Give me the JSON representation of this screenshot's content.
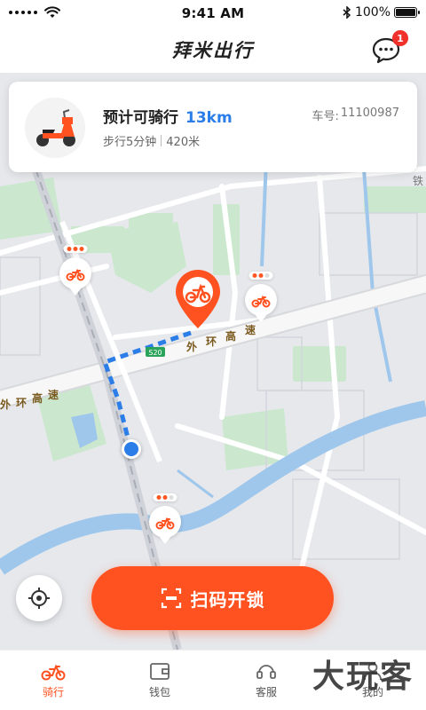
{
  "status": {
    "time": "9:41 AM",
    "battery": "100%"
  },
  "header": {
    "title": "拜米出行",
    "message_badge": "1"
  },
  "card": {
    "label": "预计可骑行",
    "range": "13km",
    "walk": "步行5分钟",
    "distance": "420米",
    "plate_label": "车号:",
    "plate_number": "11100987"
  },
  "map": {
    "road_labels": [
      "外",
      "环",
      "高",
      "速",
      "外",
      "环",
      "高",
      "速"
    ],
    "road_code": "S20",
    "rail_label": "铁"
  },
  "markers": [
    {
      "name": "bike-marker-1",
      "battery_level": 3
    },
    {
      "name": "bike-marker-2",
      "battery_level": 2
    },
    {
      "name": "bike-marker-3",
      "battery_level": 2
    }
  ],
  "scan_button": {
    "label": "扫码开锁"
  },
  "tabs": [
    {
      "id": "ride",
      "label": "骑行",
      "icon": "bike-icon",
      "active": true
    },
    {
      "id": "wallet",
      "label": "钱包",
      "icon": "wallet-icon",
      "active": false
    },
    {
      "id": "service",
      "label": "客服",
      "icon": "headset-icon",
      "active": false
    },
    {
      "id": "me",
      "label": "我的",
      "icon": "user-icon",
      "active": false
    }
  ],
  "watermark": "大玩客",
  "colors": {
    "accent": "#ff5220",
    "blue": "#2b7de8",
    "badge": "#f0302a"
  }
}
